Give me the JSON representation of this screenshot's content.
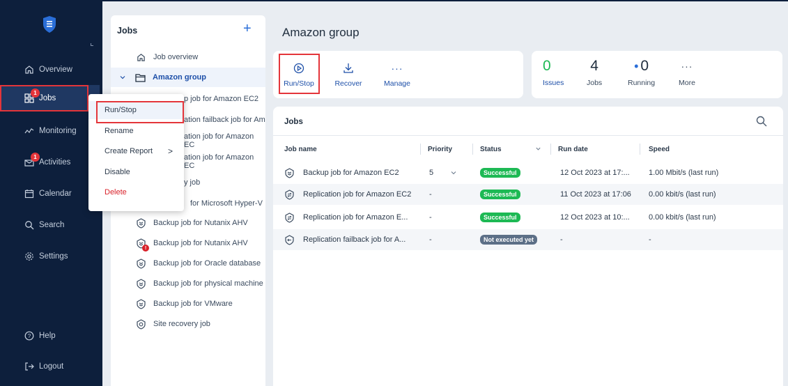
{
  "sidebar": {
    "items": [
      {
        "label": "Overview",
        "icon": "home-icon"
      },
      {
        "label": "Jobs",
        "icon": "jobs-icon",
        "badge": "1"
      },
      {
        "label": "Monitoring",
        "icon": "monitoring-icon"
      },
      {
        "label": "Activities",
        "icon": "activities-icon",
        "badge": "1"
      },
      {
        "label": "Calendar",
        "icon": "calendar-icon"
      },
      {
        "label": "Search",
        "icon": "search-icon"
      },
      {
        "label": "Settings",
        "icon": "gear-icon"
      }
    ],
    "help": "Help",
    "logout": "Logout"
  },
  "tree": {
    "title": "Jobs",
    "items": [
      {
        "label": "Job overview",
        "icon": "home-icon"
      },
      {
        "label": "Amazon group",
        "icon": "folder-icon"
      },
      {
        "label": "p job for Amazon EC2",
        "icon": "backup-job-icon"
      },
      {
        "label": "ation failback job for Am",
        "icon": "failback-job-icon"
      },
      {
        "label": "ation job for Amazon EC",
        "icon": "replication-job-icon"
      },
      {
        "label": "ation job for Amazon EC",
        "icon": "replication-job-icon"
      },
      {
        "label": "y job",
        "icon": "site-recovery-icon"
      },
      {
        "label": "for Microsoft Hyper-V",
        "icon": "backup-job-icon"
      },
      {
        "label": "Backup job for Nutanix AHV",
        "icon": "backup-job-icon"
      },
      {
        "label": "Backup job for Nutanix AHV",
        "icon": "backup-job-icon",
        "error": "!"
      },
      {
        "label": "Backup job for Oracle database",
        "icon": "backup-job-icon"
      },
      {
        "label": "Backup job for physical machine",
        "icon": "backup-job-icon"
      },
      {
        "label": "Backup job for VMware",
        "icon": "backup-job-icon"
      },
      {
        "label": "Site recovery job",
        "icon": "site-recovery-icon"
      }
    ]
  },
  "context_menu": {
    "items": [
      "Run/Stop",
      "Rename",
      "Create Report",
      "Disable",
      "Delete"
    ]
  },
  "header": {
    "title": "Amazon group"
  },
  "toolbar": {
    "run_stop": "Run/Stop",
    "recover": "Recover",
    "manage": "Manage"
  },
  "stats": {
    "issues_value": "0",
    "issues_label": "Issues",
    "jobs_value": "4",
    "jobs_label": "Jobs",
    "running_value": "0",
    "running_label": "Running",
    "more_label": "More"
  },
  "colors": {
    "sidebar_bg": "#0d1f3c",
    "accent": "#1d4fa8",
    "success": "#1db954",
    "highlight": "#e4353a"
  },
  "jobs_table": {
    "title": "Jobs",
    "columns": [
      "Job name",
      "Priority",
      "Status",
      "Run date",
      "Speed"
    ],
    "rows": [
      {
        "name": "Backup job for Amazon EC2",
        "priority": "5",
        "status": "Successful",
        "run_date": "12 Oct 2023 at 17:...",
        "speed": "1.00 Mbit/s (last run)",
        "icon": "backup-job-icon"
      },
      {
        "name": "Replication job for Amazon EC2",
        "priority": "-",
        "status": "Successful",
        "run_date": "11 Oct 2023 at 17:06",
        "speed": "0.00 kbit/s (last run)",
        "icon": "replication-job-icon"
      },
      {
        "name": "Replication job for Amazon E...",
        "priority": "-",
        "status": "Successful",
        "run_date": "12 Oct 2023 at 10:...",
        "speed": "0.00 kbit/s (last run)",
        "icon": "replication-job-icon"
      },
      {
        "name": "Replication failback job for A...",
        "priority": "-",
        "status": "Not executed yet",
        "run_date": "-",
        "speed": "-",
        "icon": "failback-job-icon"
      }
    ]
  }
}
